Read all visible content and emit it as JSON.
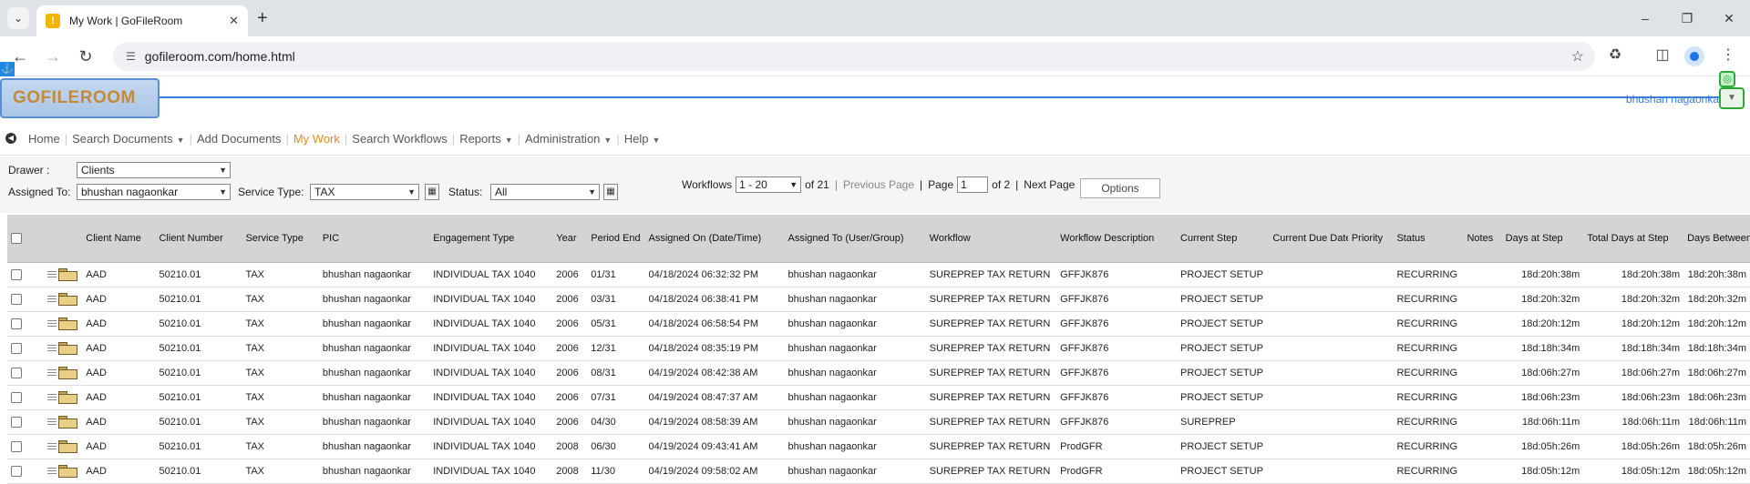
{
  "browser": {
    "tab_title": "My Work | GoFileRoom",
    "favicon_glyph": "!",
    "url": "gofileroom.com/home.html",
    "accent": "#1a73e8"
  },
  "app": {
    "logo": "GOFILEROOM",
    "user_name": "bhushan nagaonkar",
    "brand_color": "#3b7dd8",
    "active_color": "#e08a1e",
    "nav": [
      {
        "label": "Home",
        "has_menu": false
      },
      {
        "label": "Search Documents",
        "has_menu": true
      },
      {
        "label": "Add Documents",
        "has_menu": false
      },
      {
        "label": "My Work",
        "has_menu": false,
        "active": true
      },
      {
        "label": "Search Workflows",
        "has_menu": false
      },
      {
        "label": "Reports",
        "has_menu": true
      },
      {
        "label": "Administration",
        "has_menu": true
      },
      {
        "label": "Help",
        "has_menu": true
      }
    ]
  },
  "filters": {
    "drawer_label": "Drawer :",
    "drawer_value": "Clients",
    "assigned_label": "Assigned To:",
    "assigned_value": "bhushan nagaonkar",
    "service_label": "Service Type:",
    "service_value": "TAX",
    "status_label": "Status:",
    "status_value": "All"
  },
  "pager": {
    "workflows_label": "Workflows",
    "range": "1 - 20",
    "of_total": "of 21",
    "prev": "Previous Page",
    "sep": "|",
    "page_label": "Page",
    "page_value": "1",
    "of_pages": "of 2",
    "next": "Next Page",
    "options": "Options"
  },
  "table": {
    "columns": [
      "Client Name",
      "Client Number",
      "Service Type",
      "PIC",
      "Engagement Type",
      "Year",
      "Period End",
      "Assigned On (Date/Time)",
      "Assigned To (User/Group)",
      "Workflow",
      "Workflow Description",
      "Current Step",
      "Current Due Date",
      "Priority",
      "Status",
      "Notes",
      "Days at Step",
      "Total Days at Step",
      "Days Between Routing"
    ],
    "rows": [
      [
        "AAD",
        "50210.01",
        "TAX",
        "bhushan nagaonkar",
        "INDIVIDUAL TAX 1040",
        "2006",
        "01/31",
        "04/18/2024 06:32:32 PM",
        "bhushan nagaonkar",
        "SUREPREP TAX RETURN",
        "GFFJK876",
        "PROJECT SETUP",
        "",
        "",
        "RECURRING",
        "",
        "18d:20h:38m",
        "18d:20h:38m",
        "18d:20h:38m"
      ],
      [
        "AAD",
        "50210.01",
        "TAX",
        "bhushan nagaonkar",
        "INDIVIDUAL TAX 1040",
        "2006",
        "03/31",
        "04/18/2024 06:38:41 PM",
        "bhushan nagaonkar",
        "SUREPREP TAX RETURN",
        "GFFJK876",
        "PROJECT SETUP",
        "",
        "",
        "RECURRING",
        "",
        "18d:20h:32m",
        "18d:20h:32m",
        "18d:20h:32m"
      ],
      [
        "AAD",
        "50210.01",
        "TAX",
        "bhushan nagaonkar",
        "INDIVIDUAL TAX 1040",
        "2006",
        "05/31",
        "04/18/2024 06:58:54 PM",
        "bhushan nagaonkar",
        "SUREPREP TAX RETURN",
        "GFFJK876",
        "PROJECT SETUP",
        "",
        "",
        "RECURRING",
        "",
        "18d:20h:12m",
        "18d:20h:12m",
        "18d:20h:12m"
      ],
      [
        "AAD",
        "50210.01",
        "TAX",
        "bhushan nagaonkar",
        "INDIVIDUAL TAX 1040",
        "2006",
        "12/31",
        "04/18/2024 08:35:19 PM",
        "bhushan nagaonkar",
        "SUREPREP TAX RETURN",
        "GFFJK876",
        "PROJECT SETUP",
        "",
        "",
        "RECURRING",
        "",
        "18d:18h:34m",
        "18d:18h:34m",
        "18d:18h:34m"
      ],
      [
        "AAD",
        "50210.01",
        "TAX",
        "bhushan nagaonkar",
        "INDIVIDUAL TAX 1040",
        "2006",
        "08/31",
        "04/19/2024 08:42:38 AM",
        "bhushan nagaonkar",
        "SUREPREP TAX RETURN",
        "GFFJK876",
        "PROJECT SETUP",
        "",
        "",
        "RECURRING",
        "",
        "18d:06h:27m",
        "18d:06h:27m",
        "18d:06h:27m"
      ],
      [
        "AAD",
        "50210.01",
        "TAX",
        "bhushan nagaonkar",
        "INDIVIDUAL TAX 1040",
        "2006",
        "07/31",
        "04/19/2024 08:47:37 AM",
        "bhushan nagaonkar",
        "SUREPREP TAX RETURN",
        "GFFJK876",
        "PROJECT SETUP",
        "",
        "",
        "RECURRING",
        "",
        "18d:06h:23m",
        "18d:06h:23m",
        "18d:06h:23m"
      ],
      [
        "AAD",
        "50210.01",
        "TAX",
        "bhushan nagaonkar",
        "INDIVIDUAL TAX 1040",
        "2006",
        "04/30",
        "04/19/2024 08:58:39 AM",
        "bhushan nagaonkar",
        "SUREPREP TAX RETURN",
        "GFFJK876",
        "SUREPREP",
        "",
        "",
        "RECURRING",
        "",
        "18d:06h:11m",
        "18d:06h:11m",
        "18d:06h:11m"
      ],
      [
        "AAD",
        "50210.01",
        "TAX",
        "bhushan nagaonkar",
        "INDIVIDUAL TAX 1040",
        "2008",
        "06/30",
        "04/19/2024 09:43:41 AM",
        "bhushan nagaonkar",
        "SUREPREP TAX RETURN",
        "ProdGFR",
        "PROJECT SETUP",
        "",
        "",
        "RECURRING",
        "",
        "18d:05h:26m",
        "18d:05h:26m",
        "18d:05h:26m"
      ],
      [
        "AAD",
        "50210.01",
        "TAX",
        "bhushan nagaonkar",
        "INDIVIDUAL TAX 1040",
        "2008",
        "11/30",
        "04/19/2024 09:58:02 AM",
        "bhushan nagaonkar",
        "SUREPREP TAX RETURN",
        "ProdGFR",
        "PROJECT SETUP",
        "",
        "",
        "RECURRING",
        "",
        "18d:05h:12m",
        "18d:05h:12m",
        "18d:05h:12m"
      ]
    ]
  }
}
